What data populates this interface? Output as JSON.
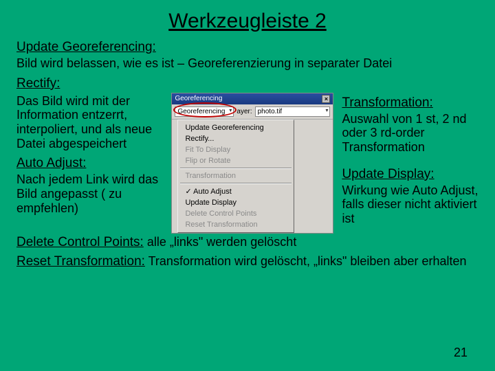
{
  "title": "Werkzeugleiste 2",
  "sections": {
    "updateGeoref": {
      "label": "Update Georeferencing:",
      "text": "Bild wird belassen, wie es ist – Georeferenzierung in separater Datei"
    },
    "rectify": {
      "label": "Rectify:",
      "text": "Das Bild wird mit der Information entzerrt, interpoliert, und als neue Datei abgespeichert"
    },
    "autoAdjust": {
      "label": "Auto Adjust:",
      "text": "Nach jedem Link wird das Bild angepasst ( zu empfehlen)"
    },
    "transformation": {
      "label": "Transformation:",
      "text": "Auswahl von 1 st, 2 nd oder 3 rd-order Transformation"
    },
    "updateDisplay": {
      "label": "Update Display:",
      "text": "Wirkung wie Auto Adjust, falls dieser nicht aktiviert ist"
    },
    "deleteCP": {
      "label": "Delete Control Points:",
      "text": " alle „links\" werden gelöscht"
    },
    "resetTrans": {
      "label": "Reset Transformation:",
      "text": " Transformation wird gelöscht, „links\" bleiben aber erhalten"
    }
  },
  "screenshot": {
    "windowTitle": "Georeferencing",
    "closeGlyph": "×",
    "dropdownLabel": "Georeferencing",
    "layerPrefix": "ayer:",
    "layerValue": "photo.tif",
    "menuItems": [
      {
        "label": "Update Georeferencing",
        "disabled": false
      },
      {
        "label": "Rectify...",
        "disabled": false
      },
      {
        "label": "Fit To Display",
        "disabled": true
      },
      {
        "label": "Flip or Rotate",
        "disabled": true,
        "sepAfter": true
      },
      {
        "label": "Transformation",
        "disabled": true,
        "sepAfter": true
      },
      {
        "label": "Auto Adjust",
        "disabled": false,
        "checked": true
      },
      {
        "label": "Update Display",
        "disabled": false
      },
      {
        "label": "Delete Control Points",
        "disabled": true
      },
      {
        "label": "Reset Transformation",
        "disabled": true
      }
    ]
  },
  "pageNumber": "21"
}
